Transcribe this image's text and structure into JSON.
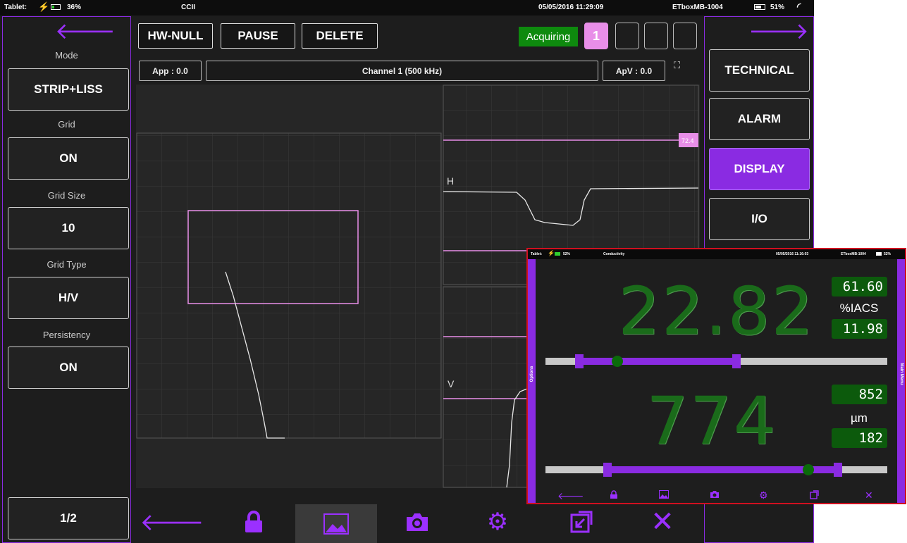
{
  "status": {
    "device": "Tablet:",
    "battery": "36%",
    "probe": "CCII",
    "datetime": "05/05/2016 11:29:09",
    "instrument": "ETboxMB-1004",
    "battery2": "51%"
  },
  "left_panel": {
    "mode_label": "Mode",
    "mode_value": "STRIP+LISS",
    "grid_label": "Grid",
    "grid_value": "ON",
    "grid_size_label": "Grid Size",
    "grid_size_value": "10",
    "grid_type_label": "Grid Type",
    "grid_type_value": "H/V",
    "persistency_label": "Persistency",
    "persistency_value": "ON",
    "page": "1/2"
  },
  "toolbar": {
    "hw_null": "HW-NULL",
    "pause": "PAUSE",
    "delete": "DELETE",
    "acquiring": "Acquiring",
    "channel_active": "1"
  },
  "info": {
    "app": "App : 0.0",
    "channel": "Channel 1 (500 kHz)",
    "apv": "ApV : 0.0"
  },
  "plots": {
    "h_label": "H",
    "v_label": "V",
    "alarm_tag": "72.4"
  },
  "right_panel": {
    "technical": "TECHNICAL",
    "alarm": "ALARM",
    "display": "DISPLAY",
    "io": "I/O"
  },
  "colors": {
    "accent": "#8a2be2",
    "acquiring": "#0e8a0e",
    "channel": "#e88ee8"
  },
  "overlay": {
    "status": {
      "device": "Tablet:",
      "battery": "52%",
      "mode": "Conductivity",
      "datetime": "05/05/2016 11:16:03",
      "instrument": "ETboxMB-1004",
      "battery2": "52%"
    },
    "left_tab": "Options",
    "right_tab": "Main Menu",
    "reading1": "22.82",
    "reading1_max": "61.60",
    "reading1_unit": "%IACS",
    "reading1_min": "11.98",
    "reading2": "774",
    "reading2_max": "852",
    "reading2_unit": "µm",
    "reading2_min": "182",
    "slider1_level": 0.21,
    "slider2_level": 0.77
  }
}
